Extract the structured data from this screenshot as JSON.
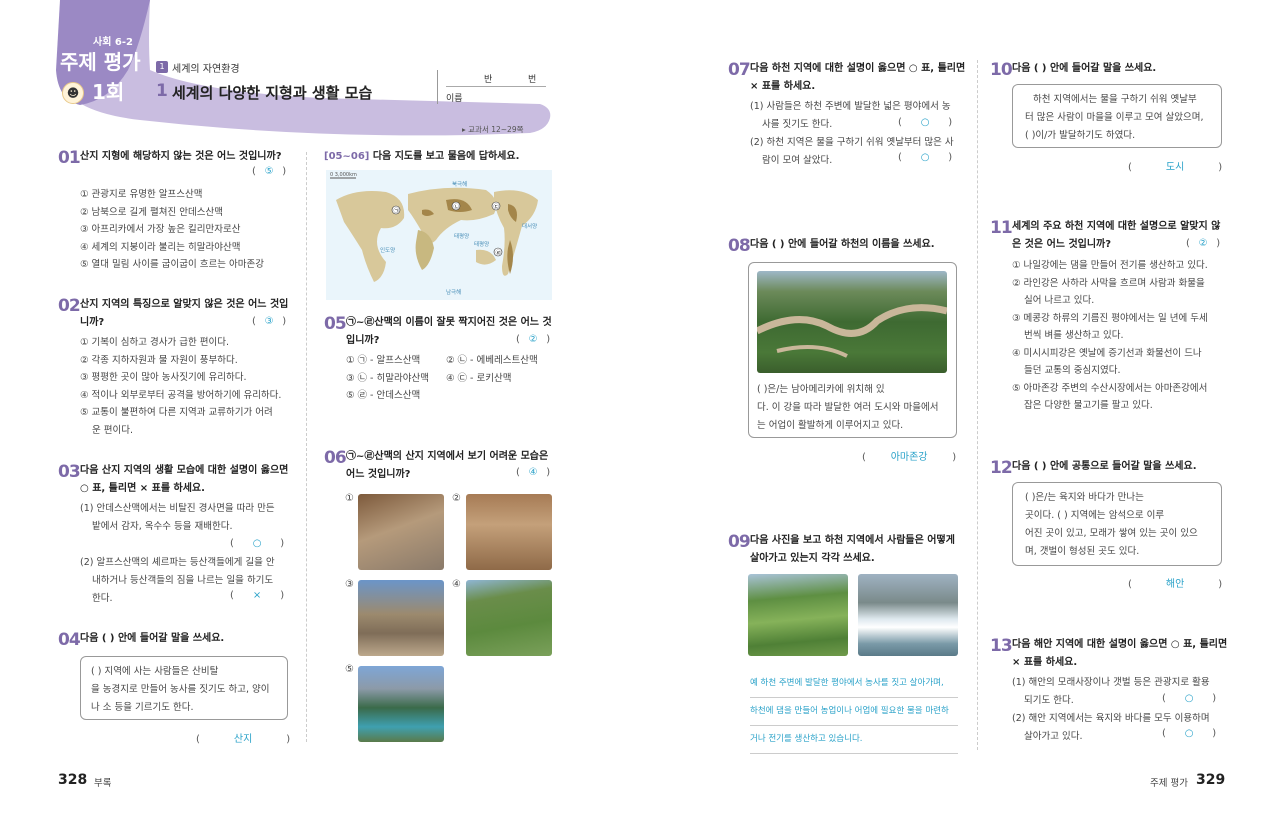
{
  "header": {
    "badge": "사회 6-2",
    "title_a": "주제 평가",
    "title_b": "1회",
    "unit_num": "1",
    "unit_name": "세계의 자연환경",
    "lesson_num": "1",
    "lesson_title": "세계의 다양한 지형과 생활 모습",
    "class_label": "반",
    "number_label": "번",
    "name_label": "이름",
    "textbook_ref": "▸ 교과서 12~29쪽"
  },
  "q01": {
    "num": "01",
    "text": "산지 지형에 해당하지 않는 것은 어느 것입니까?",
    "answer": "⑤",
    "options": [
      "① 관광지로 유명한 알프스산맥",
      "② 남북으로 길게 펼쳐진 안데스산맥",
      "③ 아프리카에서 가장 높은 킬리만자로산",
      "④ 세계의 지붕이라 불리는 히말라야산맥",
      "⑤ 열대 밀림 사이를 굽이굽이 흐르는 아마존강"
    ]
  },
  "q02": {
    "num": "02",
    "text1": "산지 지역의 특징으로 알맞지 않은 것은 어느 것입",
    "text2": "니까?",
    "answer": "③",
    "options": [
      "① 기복이 심하고 경사가 급한 편이다.",
      "② 각종 지하자원과 물 자원이 풍부하다.",
      "③ 평평한 곳이 많아 농사짓기에 유리하다.",
      "④ 적이나 외부로부터 공격을 방어하기에 유리하다.",
      "⑤ 교통이 불편하여 다른 지역과 교류하기가 어려",
      "   운 편이다."
    ]
  },
  "q03": {
    "num": "03",
    "text1": "다음 산지 지역의 생활 모습에 대한 설명이 옳으면",
    "text2": "○ 표, 틀리면 × 표를 하세요.",
    "s1": [
      "(1) 안데스산맥에서는 비탈진 경사면을 따라 만든",
      "밭에서 감자, 옥수수 등을 재배한다."
    ],
    "a1": "○",
    "s2": [
      "(2) 알프스산맥의 셰르파는 등산객들에게 길을 안",
      "내하거나 등산객들의 짐을 나르는 일을 하기도",
      "한다."
    ],
    "a2": "×"
  },
  "q04": {
    "num": "04",
    "text": "다음 (     ) 안에 들어갈 말을 쓰세요.",
    "box": [
      "(               ) 지역에 사는 사람들은 산비탈",
      "을 농경지로 만들어 농사를 짓기도 하고, 양이",
      "나 소 등을 기르기도 한다."
    ],
    "answer": "산지"
  },
  "q05_06": {
    "range": "[05~06]",
    "text": "다음 지도를 보고 물음에 답하세요.",
    "map_labels": {
      "pacific": "태평양",
      "atlantic": "대서양",
      "indian": "인도양",
      "arctic": "북극해",
      "southern": "남극해",
      "pacific2": "태평양",
      "scale": "0   3,000km"
    }
  },
  "q05": {
    "num": "05",
    "text1": "㉠~㉣산맥의 이름이 잘못 짝지어진 것은 어느 것",
    "text2": "입니까?",
    "answer": "②",
    "options": [
      [
        "① ㉠ - 알프스산맥",
        "② ㉡ - 에베레스트산맥"
      ],
      [
        "③ ㉡ - 히말라야산맥",
        "④ ㉢ - 로키산맥"
      ],
      [
        "⑤ ㉣ - 안데스산맥",
        ""
      ]
    ]
  },
  "q06": {
    "num": "06",
    "text1": "㉠~㉣산맥의 산지 지역에서 보기 어려운 모습은",
    "text2": "어느 것입니까?",
    "answer": "④",
    "labels": [
      "①",
      "②",
      "③",
      "④",
      "⑤"
    ]
  },
  "q07": {
    "num": "07",
    "text1": "다음 하천 지역에 대한 설명이 옳으면 ○ 표, 틀리면",
    "text2": "× 표를 하세요.",
    "s1": [
      "(1) 사람들은 하천 주변에 발달한 넓은 평야에서 농",
      "사를 짓기도 한다."
    ],
    "a1": "○",
    "s2": [
      "(2) 하천 지역은 물을 구하기 쉬워 옛날부터 많은 사",
      "람이 모여 살았다."
    ],
    "a2": "○"
  },
  "q08": {
    "num": "08",
    "text": "다음 (     ) 안에 들어갈 하천의 이름을 쓰세요.",
    "box": [
      "(               )은/는 남아메리카에 위치해 있",
      "다. 이 강을 따라 발달한 여러 도시와 마을에서",
      "는 어업이 활발하게 이루어지고 있다."
    ],
    "answer": "아마존강"
  },
  "q09": {
    "num": "09",
    "text1": "다음 사진을 보고 하천 지역에서 사람들은 어떻게",
    "text2": "살아가고 있는지 각각 쓰세요.",
    "answer": [
      "예 하천 주변에 발달한 평야에서 농사를 짓고 살아가며,",
      "하천에 댐을 만들어 농업이나 어업에 필요한 물을 마련하",
      "거나 전기를 생산하고 있습니다."
    ]
  },
  "q10": {
    "num": "10",
    "text": "다음 (     ) 안에 들어갈 말을 쓰세요.",
    "box": [
      "하천 지역에서는 물을 구하기 쉬워 옛날부",
      "터 많은 사람이 마을을 이루고 모여 살았으며,",
      "(               )이/가 발달하기도 하였다."
    ],
    "answer": "도시"
  },
  "q11": {
    "num": "11",
    "text1": "세계의 주요 하천 지역에 대한 설명으로 알맞지 않",
    "text2": "은 것은 어느 것입니까?",
    "answer": "②",
    "options": [
      "① 나일강에는 댐을 만들어 전기를 생산하고 있다.",
      "② 라인강은 사하라 사막을 흐르며 사람과 화물을",
      "   실어 나르고 있다.",
      "③ 메콩강 하류의 기름진 평야에서는 일 년에 두세",
      "   번씩 벼를 생산하고 있다.",
      "④ 미시시피강은 옛날에 증기선과 화물선이 드나",
      "   들던 교통의 중심지였다.",
      "⑤ 아마존강 주변의 수산시장에서는 아마존강에서",
      "   잡은 다양한 물고기를 팔고 있다."
    ]
  },
  "q12": {
    "num": "12",
    "text": "다음 (     ) 안에 공통으로 들어갈 말을 쓰세요.",
    "box": [
      "(               )은/는 육지와 바다가 만나는",
      "곳이다. (               ) 지역에는 암석으로 이루",
      "어진 곳이 있고, 모래가 쌓여 있는 곳이 있으",
      "며, 갯벌이 형성된 곳도 있다."
    ],
    "answer": "해안"
  },
  "q13": {
    "num": "13",
    "text1": "다음 해안 지역에 대한 설명이 옳으면 ○ 표, 틀리면",
    "text2": "× 표를 하세요.",
    "s1": [
      "(1) 해안의 모래사장이나 갯벌 등은 관광지로 활용",
      "되기도 한다."
    ],
    "a1": "○",
    "s2": [
      "(2) 해안 지역에서는 육지와 바다를 모두 이용하며",
      "살아가고 있다."
    ],
    "a2": "○"
  },
  "footer": {
    "left_page": "328",
    "left_label": "부록",
    "right_label": "주제 평가",
    "right_page": "329"
  },
  "colors": {
    "accent": "#7d6aa8",
    "answer": "#2aa2c9",
    "banner": "#c9bde0"
  }
}
